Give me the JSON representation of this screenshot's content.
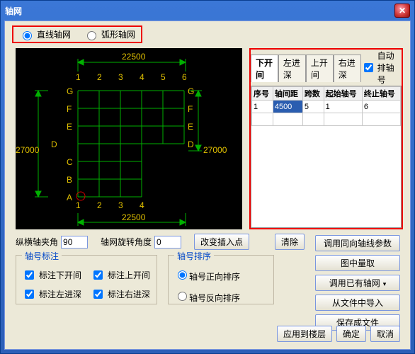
{
  "window": {
    "title": "轴网"
  },
  "grid_type": {
    "linear": "直线轴网",
    "arc": "弧形轴网",
    "selected": "linear"
  },
  "diagram": {
    "top_dim": "22500",
    "bottom_dim": "22500",
    "left_dim": "27000",
    "right_dim": "27000",
    "top_labels": [
      "1",
      "2",
      "3",
      "4",
      "5",
      "6"
    ],
    "bottom_labels": [
      "1",
      "2",
      "3",
      "4"
    ],
    "row_labels": [
      "G",
      "F",
      "E",
      "D",
      "C",
      "B",
      "A"
    ],
    "right_row_labels": [
      "G",
      "F",
      "E",
      "D"
    ]
  },
  "tabs": {
    "items": [
      "下开间",
      "左进深",
      "上开间",
      "右进深"
    ],
    "active": 0,
    "auto_label": "自动排轴号",
    "auto_checked": true,
    "columns": [
      "序号",
      "轴间距",
      "跨数",
      "起始轴号",
      "终止轴号"
    ],
    "rows": [
      {
        "序号": "1",
        "轴间距": "4500",
        "跨数": "5",
        "起始轴号": "1",
        "终止轴号": "6"
      }
    ],
    "selected_cell": {
      "row": 0,
      "col": "轴间距"
    }
  },
  "angle_row": {
    "label1": "纵横轴夹角",
    "val1": "90",
    "label2": "轴网旋转角度",
    "val2": "0",
    "insert_btn": "改变插入点",
    "clear_btn": "清除"
  },
  "annot_group": {
    "title": "轴号标注",
    "items": [
      "标注下开间",
      "标注上开间",
      "标注左进深",
      "标注右进深"
    ],
    "checked": [
      true,
      true,
      true,
      true
    ]
  },
  "sort_group": {
    "title": "轴号排序",
    "items": [
      "轴号正向排序",
      "轴号反向排序"
    ],
    "selected": 0
  },
  "right_buttons": [
    "调用同向轴线参数",
    "图中量取",
    "调用已有轴网",
    "从文件中导入",
    "保存成文件"
  ],
  "right_button_arrows": [
    false,
    false,
    true,
    false,
    false
  ],
  "bottom_buttons": [
    "应用到楼层",
    "确定",
    "取消"
  ]
}
